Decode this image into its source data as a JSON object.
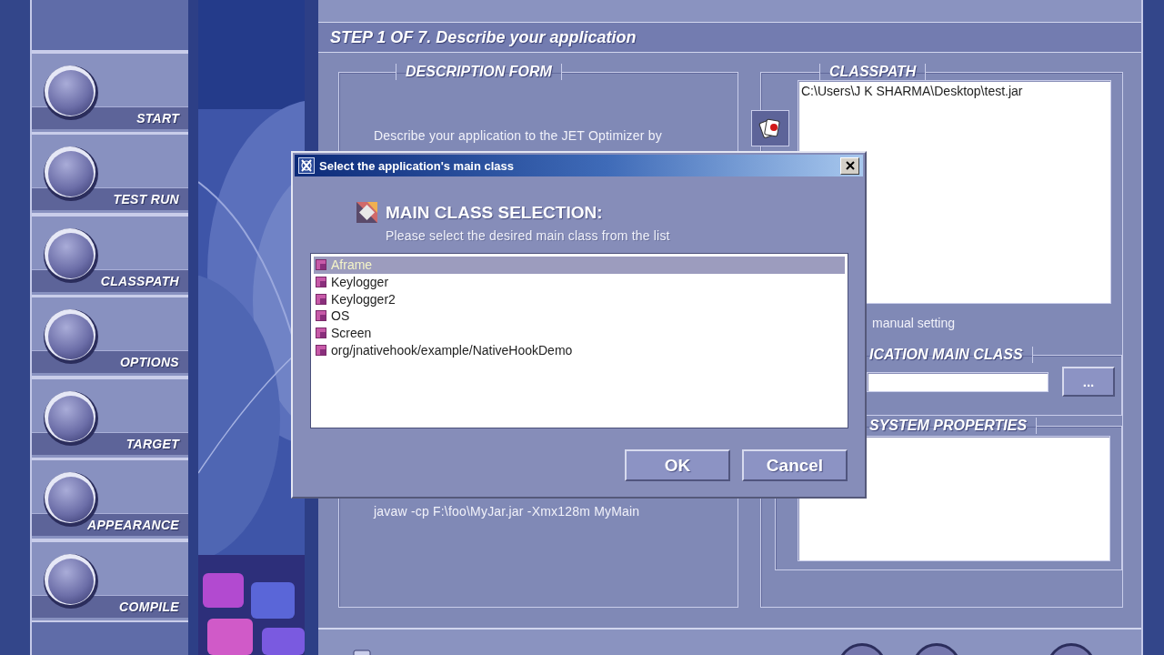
{
  "sidebar": {
    "items": [
      {
        "label": "START"
      },
      {
        "label": "TEST RUN"
      },
      {
        "label": "CLASSPATH"
      },
      {
        "label": "OPTIONS"
      },
      {
        "label": "TARGET"
      },
      {
        "label": "APPEARANCE"
      },
      {
        "label": "COMPILE"
      }
    ]
  },
  "step_title": "STEP 1 OF 7. Describe your application",
  "description_form": {
    "title": "DESCRIPTION FORM",
    "intro": "Describe your application to the JET Optimizer by",
    "example": "javaw -cp F:\\foo\\MyJar.jar -Xmx128m MyMain"
  },
  "classpath": {
    "title": "CLASSPATH",
    "entries": [
      "C:\\Users\\J K SHARMA\\Desktop\\test.jar"
    ],
    "note": "manual setting"
  },
  "main_class": {
    "title": "ICATION MAIN CLASS",
    "browse_button": "..."
  },
  "system_properties": {
    "title": "SYSTEM PROPERTIES"
  },
  "dialog": {
    "title": "Select the application's main class",
    "heading": "MAIN CLASS SELECTION:",
    "subtitle": "Please select the desired main class from the list",
    "classes": [
      {
        "name": "Aframe",
        "selected": true
      },
      {
        "name": "Keylogger",
        "selected": false
      },
      {
        "name": "Keylogger2",
        "selected": false
      },
      {
        "name": "OS",
        "selected": false
      },
      {
        "name": "Screen",
        "selected": false
      },
      {
        "name": "org/jnativehook/example/NativeHookDemo",
        "selected": false
      }
    ],
    "buttons": [
      {
        "label": "OK"
      },
      {
        "label": "Cancel"
      }
    ]
  }
}
